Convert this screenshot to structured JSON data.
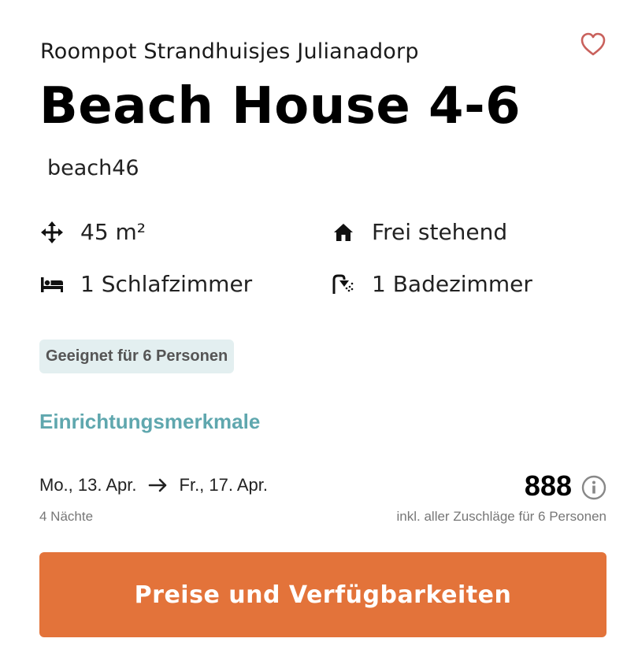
{
  "park_name": "Roompot Strandhuisjes Julianadorp",
  "house_title": "Beach House 4-6",
  "house_code": "beach46",
  "features": {
    "area": "45 m²",
    "type": "Frei stehend",
    "bedrooms": "1 Schlafzimmer",
    "bathrooms": "1 Badezimmer"
  },
  "capacity_badge": "Geeignet für 6 Personen",
  "features_link": "Einrichtungsmerkmale",
  "stay": {
    "check_in": "Mo., 13. Apr.",
    "check_out": "Fr., 17. Apr.",
    "nights": "4 Nächte"
  },
  "price": {
    "amount": "888",
    "note": "inkl. aller Zuschläge für 6 Personen"
  },
  "cta_label": "Preise und Verfügbarkeiten",
  "colors": {
    "accent_orange": "#e3733a",
    "link_teal": "#5fa7ae",
    "badge_bg": "#e3eff0",
    "heart": "#c9615c"
  },
  "icons": [
    "heart-icon",
    "move-arrows-icon",
    "house-icon",
    "bed-icon",
    "shower-icon",
    "arrow-right-icon",
    "info-icon"
  ]
}
